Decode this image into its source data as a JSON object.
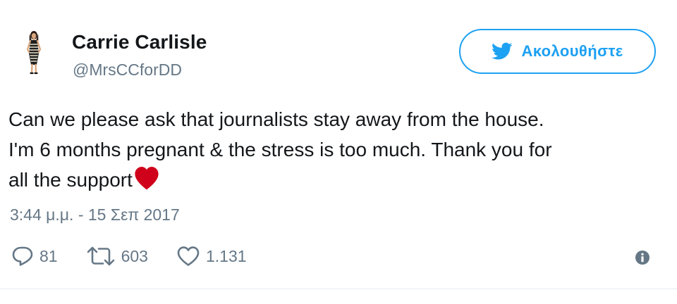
{
  "author": {
    "display_name": "Carrie Carlisle",
    "handle": "@MrsCCforDD"
  },
  "follow_button": {
    "label": "Ακολουθήστε",
    "icon": "twitter-bird-icon"
  },
  "tweet": {
    "lines": [
      "Can we please ask that journalists stay away from the house.",
      "I'm 6 months pregnant & the stress is too much. Thank you for",
      "all the support"
    ],
    "emoji": "red-heart-icon",
    "timestamp": "3:44 μ.μ. - 15 Σεπ 2017"
  },
  "actions": {
    "reply": {
      "icon": "reply-icon",
      "count": "81"
    },
    "retweet": {
      "icon": "retweet-icon",
      "count": "603"
    },
    "like": {
      "icon": "heart-icon",
      "count": "1.131"
    },
    "info": {
      "icon": "info-icon"
    }
  },
  "colors": {
    "accent": "#1da1f2",
    "secondary_text": "#657786",
    "primary_text": "#14171a",
    "heart_emoji": "#d0021b",
    "divider": "#e6ecf0"
  }
}
